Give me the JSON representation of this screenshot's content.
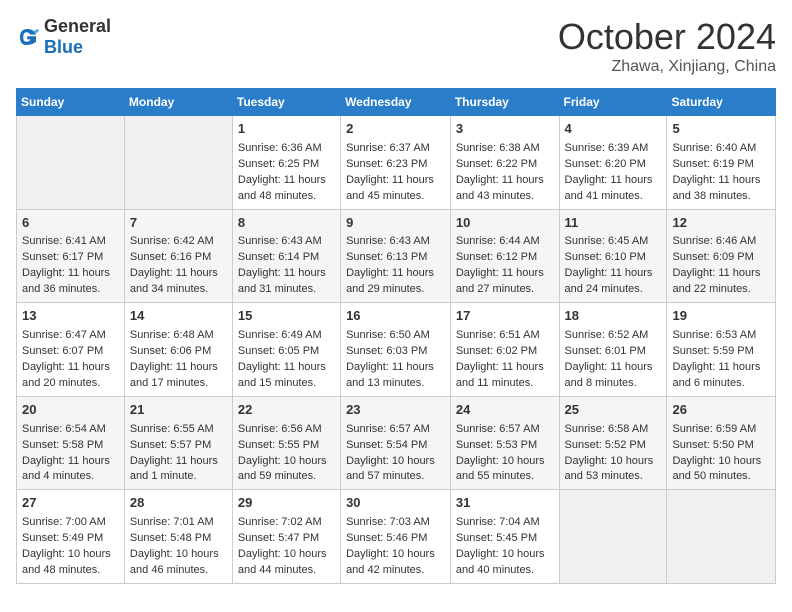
{
  "header": {
    "logo_general": "General",
    "logo_blue": "Blue",
    "title": "October 2024",
    "location": "Zhawa, Xinjiang, China"
  },
  "days_of_week": [
    "Sunday",
    "Monday",
    "Tuesday",
    "Wednesday",
    "Thursday",
    "Friday",
    "Saturday"
  ],
  "weeks": [
    [
      {
        "day": "",
        "empty": true
      },
      {
        "day": "",
        "empty": true
      },
      {
        "day": "1",
        "sunrise": "Sunrise: 6:36 AM",
        "sunset": "Sunset: 6:25 PM",
        "daylight": "Daylight: 11 hours and 48 minutes."
      },
      {
        "day": "2",
        "sunrise": "Sunrise: 6:37 AM",
        "sunset": "Sunset: 6:23 PM",
        "daylight": "Daylight: 11 hours and 45 minutes."
      },
      {
        "day": "3",
        "sunrise": "Sunrise: 6:38 AM",
        "sunset": "Sunset: 6:22 PM",
        "daylight": "Daylight: 11 hours and 43 minutes."
      },
      {
        "day": "4",
        "sunrise": "Sunrise: 6:39 AM",
        "sunset": "Sunset: 6:20 PM",
        "daylight": "Daylight: 11 hours and 41 minutes."
      },
      {
        "day": "5",
        "sunrise": "Sunrise: 6:40 AM",
        "sunset": "Sunset: 6:19 PM",
        "daylight": "Daylight: 11 hours and 38 minutes."
      }
    ],
    [
      {
        "day": "6",
        "sunrise": "Sunrise: 6:41 AM",
        "sunset": "Sunset: 6:17 PM",
        "daylight": "Daylight: 11 hours and 36 minutes."
      },
      {
        "day": "7",
        "sunrise": "Sunrise: 6:42 AM",
        "sunset": "Sunset: 6:16 PM",
        "daylight": "Daylight: 11 hours and 34 minutes."
      },
      {
        "day": "8",
        "sunrise": "Sunrise: 6:43 AM",
        "sunset": "Sunset: 6:14 PM",
        "daylight": "Daylight: 11 hours and 31 minutes."
      },
      {
        "day": "9",
        "sunrise": "Sunrise: 6:43 AM",
        "sunset": "Sunset: 6:13 PM",
        "daylight": "Daylight: 11 hours and 29 minutes."
      },
      {
        "day": "10",
        "sunrise": "Sunrise: 6:44 AM",
        "sunset": "Sunset: 6:12 PM",
        "daylight": "Daylight: 11 hours and 27 minutes."
      },
      {
        "day": "11",
        "sunrise": "Sunrise: 6:45 AM",
        "sunset": "Sunset: 6:10 PM",
        "daylight": "Daylight: 11 hours and 24 minutes."
      },
      {
        "day": "12",
        "sunrise": "Sunrise: 6:46 AM",
        "sunset": "Sunset: 6:09 PM",
        "daylight": "Daylight: 11 hours and 22 minutes."
      }
    ],
    [
      {
        "day": "13",
        "sunrise": "Sunrise: 6:47 AM",
        "sunset": "Sunset: 6:07 PM",
        "daylight": "Daylight: 11 hours and 20 minutes."
      },
      {
        "day": "14",
        "sunrise": "Sunrise: 6:48 AM",
        "sunset": "Sunset: 6:06 PM",
        "daylight": "Daylight: 11 hours and 17 minutes."
      },
      {
        "day": "15",
        "sunrise": "Sunrise: 6:49 AM",
        "sunset": "Sunset: 6:05 PM",
        "daylight": "Daylight: 11 hours and 15 minutes."
      },
      {
        "day": "16",
        "sunrise": "Sunrise: 6:50 AM",
        "sunset": "Sunset: 6:03 PM",
        "daylight": "Daylight: 11 hours and 13 minutes."
      },
      {
        "day": "17",
        "sunrise": "Sunrise: 6:51 AM",
        "sunset": "Sunset: 6:02 PM",
        "daylight": "Daylight: 11 hours and 11 minutes."
      },
      {
        "day": "18",
        "sunrise": "Sunrise: 6:52 AM",
        "sunset": "Sunset: 6:01 PM",
        "daylight": "Daylight: 11 hours and 8 minutes."
      },
      {
        "day": "19",
        "sunrise": "Sunrise: 6:53 AM",
        "sunset": "Sunset: 5:59 PM",
        "daylight": "Daylight: 11 hours and 6 minutes."
      }
    ],
    [
      {
        "day": "20",
        "sunrise": "Sunrise: 6:54 AM",
        "sunset": "Sunset: 5:58 PM",
        "daylight": "Daylight: 11 hours and 4 minutes."
      },
      {
        "day": "21",
        "sunrise": "Sunrise: 6:55 AM",
        "sunset": "Sunset: 5:57 PM",
        "daylight": "Daylight: 11 hours and 1 minute."
      },
      {
        "day": "22",
        "sunrise": "Sunrise: 6:56 AM",
        "sunset": "Sunset: 5:55 PM",
        "daylight": "Daylight: 10 hours and 59 minutes."
      },
      {
        "day": "23",
        "sunrise": "Sunrise: 6:57 AM",
        "sunset": "Sunset: 5:54 PM",
        "daylight": "Daylight: 10 hours and 57 minutes."
      },
      {
        "day": "24",
        "sunrise": "Sunrise: 6:57 AM",
        "sunset": "Sunset: 5:53 PM",
        "daylight": "Daylight: 10 hours and 55 minutes."
      },
      {
        "day": "25",
        "sunrise": "Sunrise: 6:58 AM",
        "sunset": "Sunset: 5:52 PM",
        "daylight": "Daylight: 10 hours and 53 minutes."
      },
      {
        "day": "26",
        "sunrise": "Sunrise: 6:59 AM",
        "sunset": "Sunset: 5:50 PM",
        "daylight": "Daylight: 10 hours and 50 minutes."
      }
    ],
    [
      {
        "day": "27",
        "sunrise": "Sunrise: 7:00 AM",
        "sunset": "Sunset: 5:49 PM",
        "daylight": "Daylight: 10 hours and 48 minutes."
      },
      {
        "day": "28",
        "sunrise": "Sunrise: 7:01 AM",
        "sunset": "Sunset: 5:48 PM",
        "daylight": "Daylight: 10 hours and 46 minutes."
      },
      {
        "day": "29",
        "sunrise": "Sunrise: 7:02 AM",
        "sunset": "Sunset: 5:47 PM",
        "daylight": "Daylight: 10 hours and 44 minutes."
      },
      {
        "day": "30",
        "sunrise": "Sunrise: 7:03 AM",
        "sunset": "Sunset: 5:46 PM",
        "daylight": "Daylight: 10 hours and 42 minutes."
      },
      {
        "day": "31",
        "sunrise": "Sunrise: 7:04 AM",
        "sunset": "Sunset: 5:45 PM",
        "daylight": "Daylight: 10 hours and 40 minutes."
      },
      {
        "day": "",
        "empty": true
      },
      {
        "day": "",
        "empty": true
      }
    ]
  ]
}
